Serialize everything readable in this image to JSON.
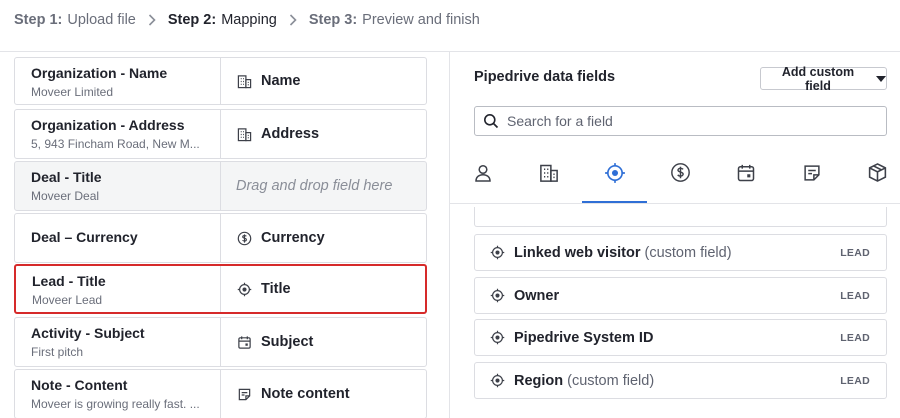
{
  "stepper": {
    "steps": [
      {
        "num": "Step 1:",
        "label": "Upload file"
      },
      {
        "num": "Step 2:",
        "label": "Mapping"
      },
      {
        "num": "Step 3:",
        "label": "Preview and finish"
      }
    ],
    "active_step": 2
  },
  "mapping_rows": [
    {
      "title": "Organization - Name",
      "sub": "Moveer Limited",
      "target": "Name",
      "icon": "building-icon"
    },
    {
      "title": "Organization - Address",
      "sub": "5, 943 Fincham Road, New M...",
      "target": "Address",
      "icon": "building-icon"
    },
    {
      "title": "Deal - Title",
      "sub": "Moveer Deal",
      "target": "Drag and drop field here",
      "icon": ""
    },
    {
      "title": "Deal – Currency",
      "sub": "",
      "target": "Currency",
      "icon": "dollar-circle-icon"
    },
    {
      "title": "Lead - Title",
      "sub": "Moveer Lead",
      "target": "Title",
      "icon": "target-icon"
    },
    {
      "title": "Activity - Subject",
      "sub": "First pitch",
      "target": "Subject",
      "icon": "calendar-icon"
    },
    {
      "title": "Note - Content",
      "sub": "Moveer is growing really fast. ...",
      "target": "Note content",
      "icon": "note-icon"
    }
  ],
  "right_panel": {
    "title": "Pipedrive data fields",
    "add_button": "Add custom field",
    "search_placeholder": "Search for a field",
    "tabs": [
      "person-icon",
      "building-icon",
      "target-icon",
      "dollar-circle-icon",
      "calendar-icon",
      "note-icon",
      "box-icon"
    ],
    "active_tab": 2,
    "fields": [
      {
        "name": "Linked web visitor",
        "custom": "(custom field)",
        "badge": "LEAD"
      },
      {
        "name": "Owner",
        "custom": "",
        "badge": "LEAD"
      },
      {
        "name": "Pipedrive System ID",
        "custom": "",
        "badge": "LEAD"
      },
      {
        "name": "Region",
        "custom": "(custom field)",
        "badge": "LEAD"
      }
    ]
  },
  "colors": {
    "accent": "#2f6fd6",
    "selected_border": "#d62a2a",
    "text": "#21232c",
    "muted": "#6a6e7a"
  }
}
